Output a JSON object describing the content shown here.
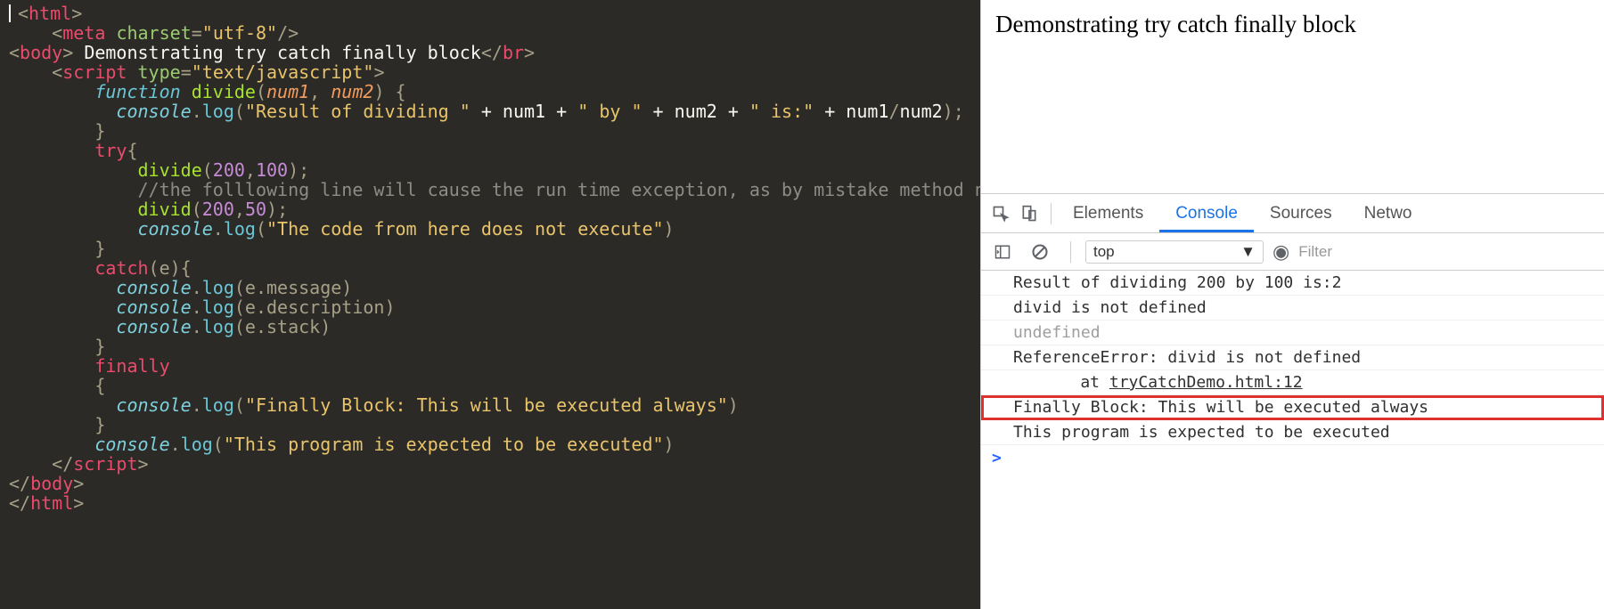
{
  "editor": {
    "lines": [
      [
        [
          "cursor",
          ""
        ],
        [
          "p",
          "<"
        ],
        [
          "tg",
          "html"
        ],
        [
          "p",
          ">"
        ]
      ],
      [
        [
          "sp",
          "    "
        ],
        [
          "p",
          "<"
        ],
        [
          "tg",
          "meta"
        ],
        [
          "tx",
          " "
        ],
        [
          "a",
          "charset"
        ],
        [
          "p",
          "="
        ],
        [
          "v",
          "\"utf-8\""
        ],
        [
          "p",
          "/>"
        ]
      ],
      [
        [
          "p",
          "<"
        ],
        [
          "tg",
          "body"
        ],
        [
          "p",
          "> "
        ],
        [
          "tx",
          "Demonstrating try catch finally block"
        ],
        [
          "p",
          "</"
        ],
        [
          "tg",
          "br"
        ],
        [
          "p",
          ">"
        ]
      ],
      [
        [
          "sp",
          "    "
        ],
        [
          "p",
          "<"
        ],
        [
          "tg",
          "script"
        ],
        [
          "tx",
          " "
        ],
        [
          "a",
          "type"
        ],
        [
          "p",
          "="
        ],
        [
          "v",
          "\"text/javascript\""
        ],
        [
          "p",
          ">"
        ]
      ],
      [
        [
          "sp",
          "        "
        ],
        [
          "fn",
          "function"
        ],
        [
          "tx",
          " "
        ],
        [
          "id",
          "divide"
        ],
        [
          "p",
          "("
        ],
        [
          "pr",
          "num1"
        ],
        [
          "p",
          ", "
        ],
        [
          "pr",
          "num2"
        ],
        [
          "p",
          ") {"
        ]
      ],
      [
        [
          "sp",
          "          "
        ],
        [
          "obj",
          "console"
        ],
        [
          "p",
          "."
        ],
        [
          "fi",
          "log"
        ],
        [
          "p",
          "("
        ],
        [
          "s",
          "\"Result of dividing \""
        ],
        [
          "tx",
          " + num1 + "
        ],
        [
          "s",
          "\" by \""
        ],
        [
          "tx",
          " + num2 + "
        ],
        [
          "s",
          "\" is:\""
        ],
        [
          "tx",
          " + num1"
        ],
        [
          "p",
          "/"
        ],
        [
          "tx",
          "num2"
        ],
        [
          "p",
          ");"
        ]
      ],
      [
        [
          "sp",
          "        "
        ],
        [
          "p",
          "}"
        ]
      ],
      [
        [
          "sp",
          ""
        ]
      ],
      [
        [
          "sp",
          "        "
        ],
        [
          "kw",
          "try"
        ],
        [
          "p",
          "{"
        ]
      ],
      [
        [
          "sp",
          "            "
        ],
        [
          "id",
          "divide"
        ],
        [
          "p",
          "("
        ],
        [
          "nm",
          "200"
        ],
        [
          "p",
          ","
        ],
        [
          "nm",
          "100"
        ],
        [
          "p",
          ");"
        ]
      ],
      [
        [
          "sp",
          "            "
        ],
        [
          "cm",
          "//the folllowing line will cause the run time exception, as by mistake method name is wrong"
        ]
      ],
      [
        [
          "sp",
          "            "
        ],
        [
          "id",
          "divid"
        ],
        [
          "p",
          "("
        ],
        [
          "nm",
          "200"
        ],
        [
          "p",
          ","
        ],
        [
          "nm",
          "50"
        ],
        [
          "p",
          ");"
        ]
      ],
      [
        [
          "sp",
          "            "
        ],
        [
          "obj",
          "console"
        ],
        [
          "p",
          "."
        ],
        [
          "fi",
          "log"
        ],
        [
          "p",
          "("
        ],
        [
          "s",
          "\"The code from here does not execute\""
        ],
        [
          "p",
          ")"
        ]
      ],
      [
        [
          "sp",
          "        "
        ],
        [
          "p",
          "}"
        ]
      ],
      [
        [
          "sp",
          "        "
        ],
        [
          "kw",
          "catch"
        ],
        [
          "p",
          "(e){"
        ]
      ],
      [
        [
          "sp",
          "          "
        ],
        [
          "obj",
          "console"
        ],
        [
          "p",
          "."
        ],
        [
          "fi",
          "log"
        ],
        [
          "p",
          "(e.message)"
        ]
      ],
      [
        [
          "sp",
          "          "
        ],
        [
          "obj",
          "console"
        ],
        [
          "p",
          "."
        ],
        [
          "fi",
          "log"
        ],
        [
          "p",
          "(e.description)"
        ]
      ],
      [
        [
          "sp",
          "          "
        ],
        [
          "obj",
          "console"
        ],
        [
          "p",
          "."
        ],
        [
          "fi",
          "log"
        ],
        [
          "p",
          "(e.stack)"
        ]
      ],
      [
        [
          "sp",
          "        "
        ],
        [
          "p",
          "}"
        ]
      ],
      [
        [
          "sp",
          "        "
        ],
        [
          "kw",
          "finally"
        ]
      ],
      [
        [
          "sp",
          "        "
        ],
        [
          "p",
          "{"
        ]
      ],
      [
        [
          "sp",
          "          "
        ],
        [
          "obj",
          "console"
        ],
        [
          "p",
          "."
        ],
        [
          "fi",
          "log"
        ],
        [
          "p",
          "("
        ],
        [
          "s",
          "\"Finally Block: This will be executed always\""
        ],
        [
          "p",
          ")"
        ]
      ],
      [
        [
          "sp",
          "        "
        ],
        [
          "p",
          "}"
        ]
      ],
      [
        [
          "sp",
          "        "
        ],
        [
          "obj",
          "console"
        ],
        [
          "p",
          "."
        ],
        [
          "fi",
          "log"
        ],
        [
          "p",
          "("
        ],
        [
          "s",
          "\"This program is expected to be executed\""
        ],
        [
          "p",
          ")"
        ]
      ],
      [
        [
          "sp",
          "    "
        ],
        [
          "p",
          "</"
        ],
        [
          "tg",
          "script"
        ],
        [
          "p",
          ">"
        ]
      ],
      [
        [
          "p",
          "</"
        ],
        [
          "tg",
          "body"
        ],
        [
          "p",
          ">"
        ]
      ],
      [
        [
          "p",
          "</"
        ],
        [
          "tg",
          "html"
        ],
        [
          "p",
          ">"
        ]
      ]
    ]
  },
  "page_text": "Demonstrating try catch finally block",
  "devtools": {
    "tabs": [
      "Elements",
      "Console",
      "Sources",
      "Netwo"
    ],
    "active_tab_index": 1,
    "context": "top",
    "filter_placeholder": "Filter",
    "console_rows": [
      {
        "text": "Result of dividing 200 by 100 is:2"
      },
      {
        "text": "divid is not defined"
      },
      {
        "text": "undefined",
        "muted": true
      },
      {
        "text": "ReferenceError: divid is not defined"
      },
      {
        "text": "    at ",
        "stack": true,
        "link": "tryCatchDemo.html:12"
      },
      {
        "text": "Finally Block: This will be executed always",
        "highlight": true
      },
      {
        "text": "This program is expected to be executed"
      }
    ],
    "prompt": ">"
  }
}
